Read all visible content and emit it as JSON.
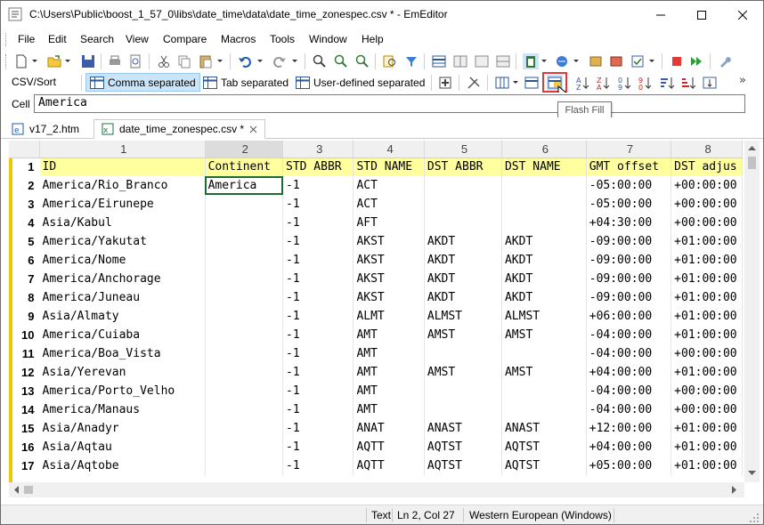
{
  "window": {
    "title": "C:\\Users\\Public\\boost_1_57_0\\libs\\date_time\\data\\date_time_zonespec.csv * - EmEditor"
  },
  "menu": [
    "File",
    "Edit",
    "Search",
    "View",
    "Compare",
    "Macros",
    "Tools",
    "Window",
    "Help"
  ],
  "csv_toolbar": {
    "label": "CSV/Sort",
    "comma": "Comma separated",
    "tab": "Tab separated",
    "user": "User-defined separated",
    "tooltip": "Flash Fill"
  },
  "cellbar": {
    "label": "Cell",
    "value": "America"
  },
  "tabs": [
    {
      "label": "v17_2.htm",
      "icon": "html-file-icon"
    },
    {
      "label": "date_time_zonespec.csv *",
      "icon": "csv-file-icon"
    }
  ],
  "grid": {
    "column_numbers": [
      "1",
      "2",
      "3",
      "4",
      "5",
      "6",
      "7",
      "8"
    ],
    "rows": [
      {
        "n": "1",
        "cells": [
          "ID",
          "Continent",
          "STD ABBR",
          "STD NAME",
          "DST ABBR",
          "DST NAME",
          "GMT offset",
          "DST adjus"
        ]
      },
      {
        "n": "2",
        "cells": [
          "America/Rio_Branco",
          "America",
          "-1",
          "ACT",
          "",
          "",
          "-05:00:00",
          "+00:00:00"
        ]
      },
      {
        "n": "3",
        "cells": [
          "America/Eirunepe",
          "",
          "-1",
          "ACT",
          "",
          "",
          "-05:00:00",
          "+00:00:00"
        ]
      },
      {
        "n": "4",
        "cells": [
          "Asia/Kabul",
          "",
          "-1",
          "AFT",
          "",
          "",
          "+04:30:00",
          "+00:00:00"
        ]
      },
      {
        "n": "5",
        "cells": [
          "America/Yakutat",
          "",
          "-1",
          "AKST",
          "AKDT",
          "AKDT",
          "-09:00:00",
          "+01:00:00"
        ]
      },
      {
        "n": "6",
        "cells": [
          "America/Nome",
          "",
          "-1",
          "AKST",
          "AKDT",
          "AKDT",
          "-09:00:00",
          "+01:00:00"
        ]
      },
      {
        "n": "7",
        "cells": [
          "America/Anchorage",
          "",
          "-1",
          "AKST",
          "AKDT",
          "AKDT",
          "-09:00:00",
          "+01:00:00"
        ]
      },
      {
        "n": "8",
        "cells": [
          "America/Juneau",
          "",
          "-1",
          "AKST",
          "AKDT",
          "AKDT",
          "-09:00:00",
          "+01:00:00"
        ]
      },
      {
        "n": "9",
        "cells": [
          "Asia/Almaty",
          "",
          "-1",
          "ALMT",
          "ALMST",
          "ALMST",
          "+06:00:00",
          "+01:00:00"
        ]
      },
      {
        "n": "10",
        "cells": [
          "America/Cuiaba",
          "",
          "-1",
          "AMT",
          "AMST",
          "AMST",
          "-04:00:00",
          "+01:00:00"
        ]
      },
      {
        "n": "11",
        "cells": [
          "America/Boa_Vista",
          "",
          "-1",
          "AMT",
          "",
          "",
          "-04:00:00",
          "+00:00:00"
        ]
      },
      {
        "n": "12",
        "cells": [
          "Asia/Yerevan",
          "",
          "-1",
          "AMT",
          "AMST",
          "AMST",
          "+04:00:00",
          "+01:00:00"
        ]
      },
      {
        "n": "13",
        "cells": [
          "America/Porto_Velho",
          "",
          "-1",
          "AMT",
          "",
          "",
          "-04:00:00",
          "+00:00:00"
        ]
      },
      {
        "n": "14",
        "cells": [
          "America/Manaus",
          "",
          "-1",
          "AMT",
          "",
          "",
          "-04:00:00",
          "+00:00:00"
        ]
      },
      {
        "n": "15",
        "cells": [
          "Asia/Anadyr",
          "",
          "-1",
          "ANAT",
          "ANAST",
          "ANAST",
          "+12:00:00",
          "+01:00:00"
        ]
      },
      {
        "n": "16",
        "cells": [
          "Asia/Aqtau",
          "",
          "-1",
          "AQTT",
          "AQTST",
          "AQTST",
          "+04:00:00",
          "+01:00:00"
        ]
      },
      {
        "n": "17",
        "cells": [
          "Asia/Aqtobe",
          "",
          "-1",
          "AQTT",
          "AQTST",
          "AQTST",
          "+05:00:00",
          "+01:00:00"
        ]
      }
    ]
  },
  "status": {
    "mode": "Text",
    "position": "Ln 2, Col 27",
    "encoding": "Western European (Windows)"
  }
}
